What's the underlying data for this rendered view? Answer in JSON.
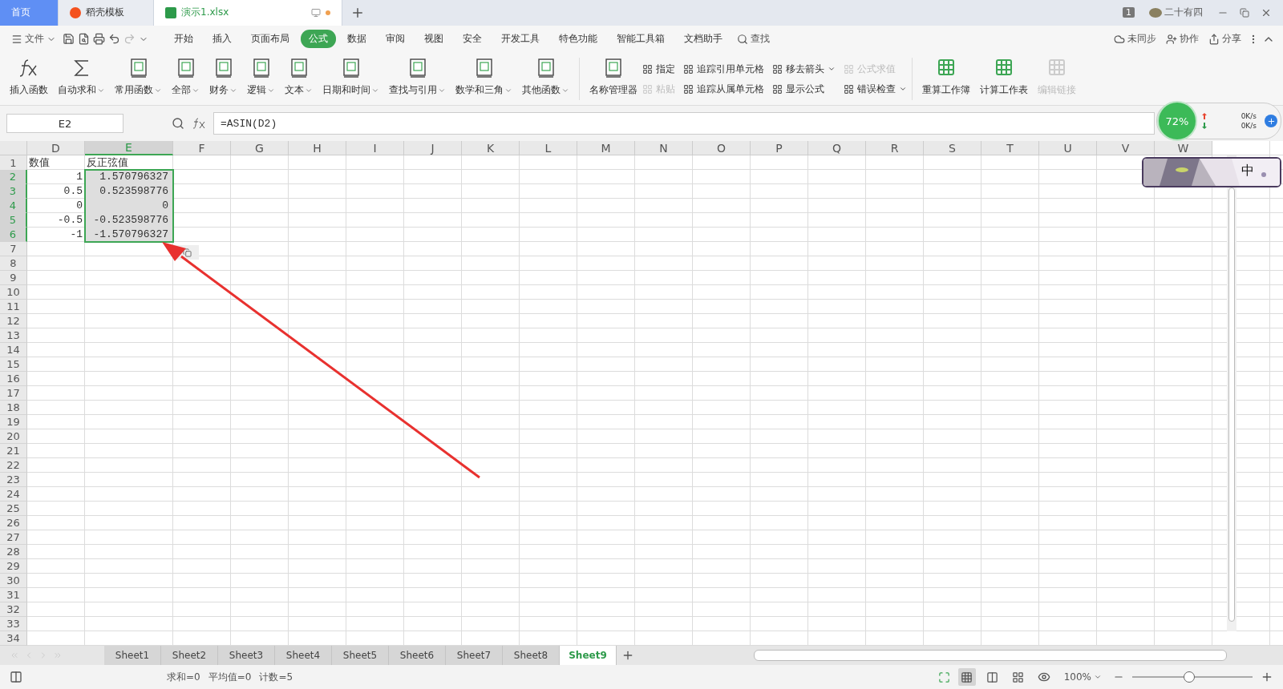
{
  "tabs": [
    {
      "label": "首页",
      "kind": "home",
      "selected": false
    },
    {
      "label": "稻壳模板",
      "kind": "docer",
      "selected": false
    },
    {
      "label": "演示1.xlsx",
      "kind": "sheet",
      "selected": true
    }
  ],
  "titlebar": {
    "badge": "1",
    "user": "二十有四"
  },
  "menu": {
    "file": "文件",
    "items": [
      {
        "label": "开始",
        "selected": false
      },
      {
        "label": "插入",
        "selected": false
      },
      {
        "label": "页面布局",
        "selected": false
      },
      {
        "label": "公式",
        "selected": true
      },
      {
        "label": "数据",
        "selected": false
      },
      {
        "label": "审阅",
        "selected": false
      },
      {
        "label": "视图",
        "selected": false
      },
      {
        "label": "安全",
        "selected": false
      },
      {
        "label": "开发工具",
        "selected": false
      },
      {
        "label": "特色功能",
        "selected": false
      },
      {
        "label": "智能工具箱",
        "selected": false
      },
      {
        "label": "文档助手",
        "selected": false
      }
    ],
    "search": "查找",
    "sync": "未同步",
    "collab": "协作",
    "share": "分享"
  },
  "ribbon": {
    "functions": [
      {
        "label": "插入函数",
        "kind": "fx",
        "dropdown": false
      },
      {
        "label": "自动求和",
        "kind": "sum",
        "dropdown": true
      },
      {
        "label": "常用函数",
        "kind": "book",
        "dropdown": true
      },
      {
        "label": "全部",
        "kind": "book",
        "dropdown": true
      },
      {
        "label": "财务",
        "kind": "book",
        "dropdown": true
      },
      {
        "label": "逻辑",
        "kind": "book",
        "dropdown": true
      },
      {
        "label": "文本",
        "kind": "book",
        "dropdown": true
      },
      {
        "label": "日期和时间",
        "kind": "book",
        "dropdown": true
      },
      {
        "label": "查找与引用",
        "kind": "book",
        "dropdown": true
      },
      {
        "label": "数学和三角",
        "kind": "book",
        "dropdown": true
      },
      {
        "label": "其他函数",
        "kind": "book",
        "dropdown": true
      }
    ],
    "names": {
      "label": "名称管理器"
    },
    "small": [
      {
        "label": "指定",
        "disabled": false,
        "dropdown": false
      },
      {
        "label": "粘贴",
        "disabled": true,
        "dropdown": false
      },
      {
        "label": "追踪引用单元格",
        "disabled": false,
        "dropdown": false
      },
      {
        "label": "追踪从属单元格",
        "disabled": false,
        "dropdown": false
      },
      {
        "label": "移去箭头",
        "disabled": false,
        "dropdown": true
      },
      {
        "label": "显示公式",
        "disabled": false,
        "dropdown": false
      },
      {
        "label": "公式求值",
        "disabled": true,
        "dropdown": false
      },
      {
        "label": "错误检查",
        "disabled": false,
        "dropdown": true
      }
    ],
    "calc": [
      {
        "label": "重算工作簿",
        "disabled": false
      },
      {
        "label": "计算工作表",
        "disabled": false
      },
      {
        "label": "编辑链接",
        "disabled": true
      }
    ]
  },
  "formula_bar": {
    "name_box": "E2",
    "formula": "=ASIN(D2)"
  },
  "net_widget": {
    "percent": "72%",
    "up": "0K/s",
    "down": "0K/s"
  },
  "ime": {
    "label": "中"
  },
  "columns": [
    {
      "label": "D",
      "selected": false
    },
    {
      "label": "E",
      "selected": true
    },
    {
      "label": "F",
      "selected": false
    },
    {
      "label": "G",
      "selected": false
    },
    {
      "label": "H",
      "selected": false
    },
    {
      "label": "I",
      "selected": false
    },
    {
      "label": "J",
      "selected": false
    },
    {
      "label": "K",
      "selected": false
    },
    {
      "label": "L",
      "selected": false
    },
    {
      "label": "M",
      "selected": false
    },
    {
      "label": "N",
      "selected": false
    },
    {
      "label": "O",
      "selected": false
    },
    {
      "label": "P",
      "selected": false
    },
    {
      "label": "Q",
      "selected": false
    },
    {
      "label": "R",
      "selected": false
    },
    {
      "label": "S",
      "selected": false
    },
    {
      "label": "T",
      "selected": false
    },
    {
      "label": "U",
      "selected": false
    },
    {
      "label": "V",
      "selected": false
    },
    {
      "label": "W",
      "selected": false
    }
  ],
  "rows": [
    {
      "label": "1",
      "selected": false,
      "cells": [
        {
          "value": "数值",
          "kind": "text"
        },
        {
          "value": "反正弦值",
          "kind": "text"
        }
      ]
    },
    {
      "label": "2",
      "selected": true,
      "cells": [
        {
          "value": "1",
          "kind": "number"
        },
        {
          "value": "1.570796327",
          "kind": "number"
        }
      ]
    },
    {
      "label": "3",
      "selected": true,
      "cells": [
        {
          "value": "0.5",
          "kind": "number"
        },
        {
          "value": "0.523598776",
          "kind": "number"
        }
      ]
    },
    {
      "label": "4",
      "selected": true,
      "cells": [
        {
          "value": "0",
          "kind": "number"
        },
        {
          "value": "0",
          "kind": "number"
        }
      ]
    },
    {
      "label": "5",
      "selected": true,
      "cells": [
        {
          "value": "-0.5",
          "kind": "number"
        },
        {
          "value": "-0.523598776",
          "kind": "number"
        }
      ]
    },
    {
      "label": "6",
      "selected": true,
      "cells": [
        {
          "value": "-1",
          "kind": "number"
        },
        {
          "value": "-1.570796327",
          "kind": "number"
        }
      ]
    },
    {
      "label": "7",
      "selected": false
    },
    {
      "label": "8",
      "selected": false
    },
    {
      "label": "9",
      "selected": false
    },
    {
      "label": "10",
      "selected": false
    },
    {
      "label": "11",
      "selected": false
    },
    {
      "label": "12",
      "selected": false
    },
    {
      "label": "13",
      "selected": false
    },
    {
      "label": "14",
      "selected": false
    },
    {
      "label": "15",
      "selected": false
    },
    {
      "label": "16",
      "selected": false
    },
    {
      "label": "17",
      "selected": false
    },
    {
      "label": "18",
      "selected": false
    },
    {
      "label": "19",
      "selected": false
    },
    {
      "label": "20",
      "selected": false
    },
    {
      "label": "21",
      "selected": false
    },
    {
      "label": "22",
      "selected": false
    },
    {
      "label": "23",
      "selected": false
    },
    {
      "label": "24",
      "selected": false
    },
    {
      "label": "25",
      "selected": false
    },
    {
      "label": "26",
      "selected": false
    },
    {
      "label": "27",
      "selected": false
    },
    {
      "label": "28",
      "selected": false
    },
    {
      "label": "29",
      "selected": false
    },
    {
      "label": "30",
      "selected": false
    },
    {
      "label": "31",
      "selected": false
    },
    {
      "label": "32",
      "selected": false
    },
    {
      "label": "33",
      "selected": false
    },
    {
      "label": "34",
      "selected": false
    }
  ],
  "sheets": [
    {
      "label": "Sheet1",
      "selected": false
    },
    {
      "label": "Sheet2",
      "selected": false
    },
    {
      "label": "Sheet3",
      "selected": false
    },
    {
      "label": "Sheet4",
      "selected": false
    },
    {
      "label": "Sheet5",
      "selected": false
    },
    {
      "label": "Sheet6",
      "selected": false
    },
    {
      "label": "Sheet7",
      "selected": false
    },
    {
      "label": "Sheet8",
      "selected": false
    },
    {
      "label": "Sheet9",
      "selected": true
    }
  ],
  "status": {
    "stats": [
      "求和=0",
      "平均值=0",
      "计数=5"
    ],
    "zoom": "100%",
    "zoom_slider": {
      "level": 0.47
    }
  }
}
